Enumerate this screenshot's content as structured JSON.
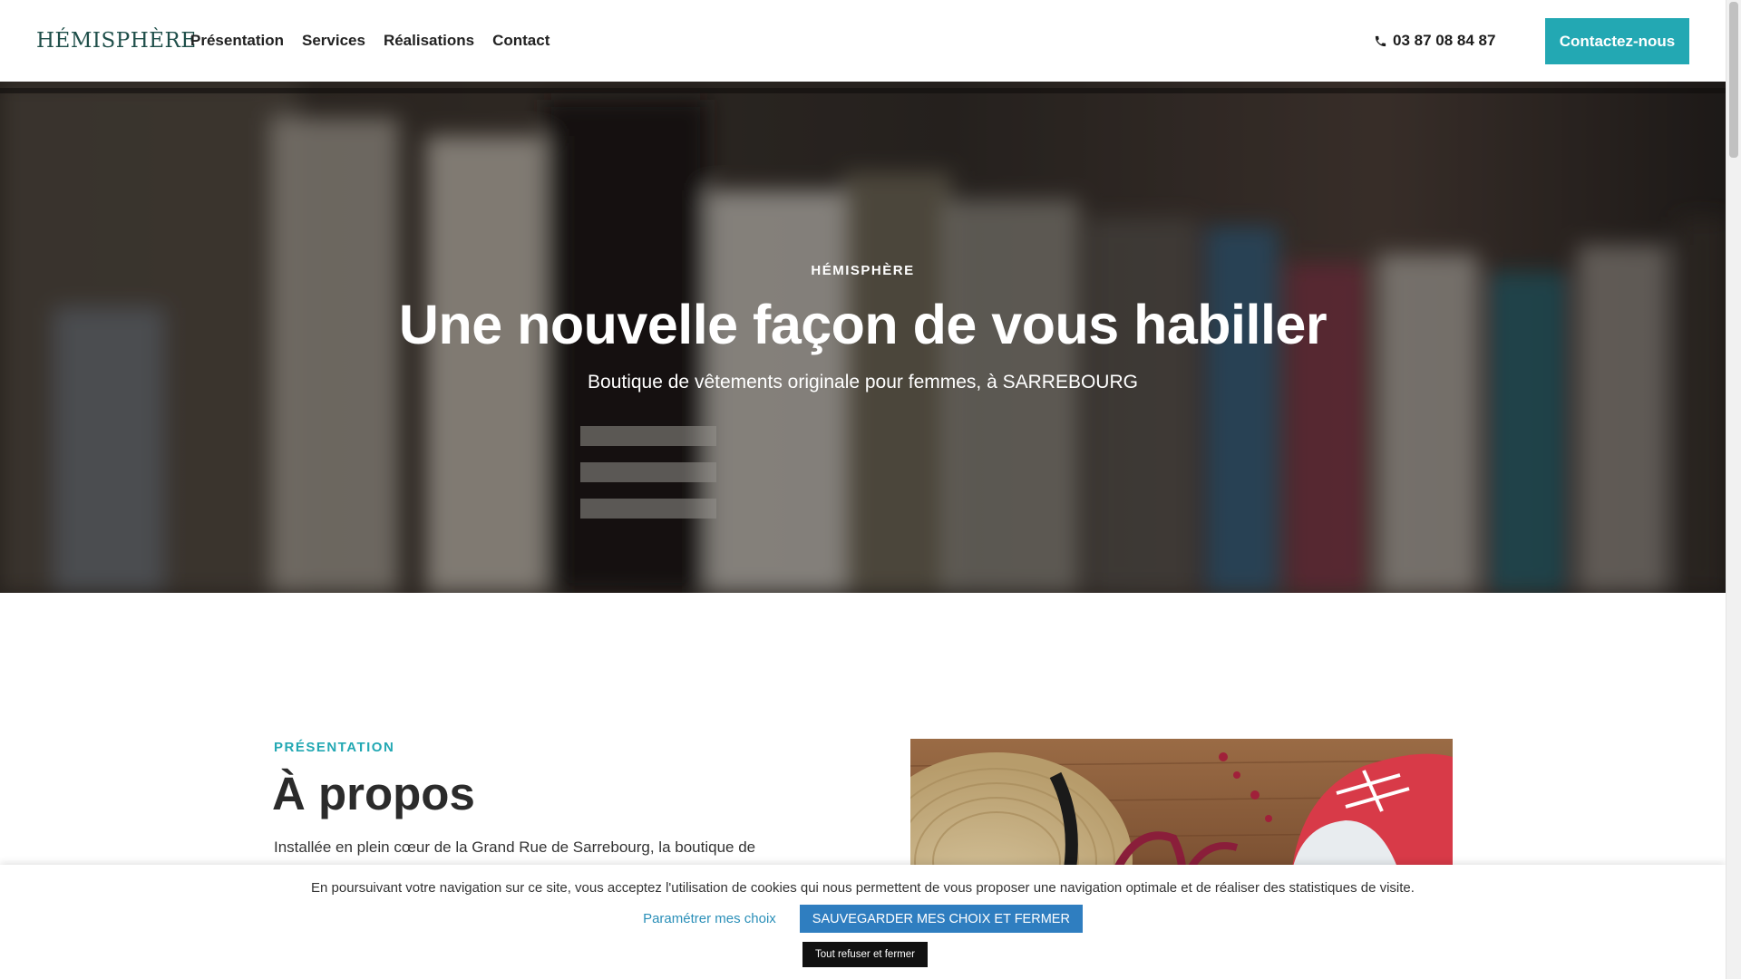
{
  "header": {
    "logo": "HÉMISPHÈRE",
    "nav": [
      {
        "label": "Présentation"
      },
      {
        "label": "Services"
      },
      {
        "label": "Réalisations"
      },
      {
        "label": "Contact"
      }
    ],
    "phone": "03 87 08 84 87",
    "cta_label": "Contactez-nous"
  },
  "hero": {
    "eyebrow": "HÉMISPHÈRE",
    "title": "Une nouvelle façon de vous habiller",
    "subtitle": "Boutique de vêtements originale pour femmes, à SARREBOURG"
  },
  "presentation": {
    "eyebrow": "PRÉSENTATION",
    "title": "À propos",
    "text": "Installée en plein cœur de la Grand Rue de Sarrebourg, la boutique de"
  },
  "cookie": {
    "text": "En poursuivant votre navigation sur ce site, vous acceptez l'utilisation de cookies qui nous permettent de vous proposer une navigation optimale et de réaliser des statistiques de visite.",
    "settings_link": "Paramétrer mes choix",
    "save_button": "SAUVEGARDER MES CHOIX ET FERMER",
    "refuse_button": "Tout refuser et fermer"
  },
  "colors": {
    "accent": "#23a8b3",
    "cookie_button": "#2f7ec0",
    "logo": "#1f4f4a"
  },
  "icons": {
    "phone": "phone-icon"
  }
}
